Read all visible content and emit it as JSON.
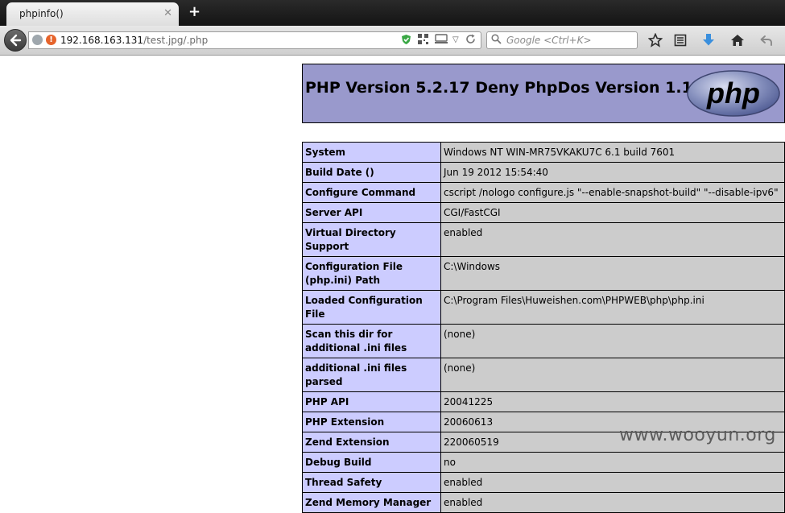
{
  "browser": {
    "tab_title": "phpinfo()",
    "tab_close_glyph": "✕",
    "new_tab_glyph": "+",
    "url_host": "192.168.163.131",
    "url_path": "/test.jpg/.php",
    "search_placeholder": "Google <Ctrl+K>",
    "icons": [
      "back-arrow-icon",
      "globe-icon",
      "warning-icon",
      "shield-icon",
      "qr-code-icon",
      "compatibility-icon",
      "dropdown-icon",
      "reload-icon",
      "search-icon",
      "bookmark-star-icon",
      "bookmarks-list-icon",
      "downloads-icon",
      "home-icon",
      "undo-icon"
    ]
  },
  "phpinfo": {
    "header_title": "PHP Version 5.2.17 Deny PhpDos Version 1.1",
    "logo_text": "php",
    "header_bg": "#9999cc",
    "key_bg": "#ccccff",
    "value_bg": "#cccccc",
    "rows": [
      {
        "key": "System",
        "value": "Windows NT WIN-MR75VKAKU7C 6.1 build 7601"
      },
      {
        "key": "Build Date ()",
        "value": "Jun 19 2012 15:54:40"
      },
      {
        "key": "Configure Command",
        "value": "cscript /nologo configure.js \"--enable-snapshot-build\" \"--disable-ipv6\""
      },
      {
        "key": "Server API",
        "value": "CGI/FastCGI"
      },
      {
        "key": "Virtual Directory Support",
        "value": "enabled"
      },
      {
        "key": "Configuration File (php.ini) Path",
        "value": "C:\\Windows"
      },
      {
        "key": "Loaded Configuration File",
        "value": "C:\\Program Files\\Huweishen.com\\PHPWEB\\php\\php.ini"
      },
      {
        "key": "Scan this dir for additional .ini files",
        "value": "(none)"
      },
      {
        "key": "additional .ini files parsed",
        "value": "(none)"
      },
      {
        "key": "PHP API",
        "value": "20041225"
      },
      {
        "key": "PHP Extension",
        "value": "20060613"
      },
      {
        "key": "Zend Extension",
        "value": "220060519"
      },
      {
        "key": "Debug Build",
        "value": "no"
      },
      {
        "key": "Thread Safety",
        "value": "enabled"
      },
      {
        "key": "Zend Memory Manager",
        "value": "enabled"
      }
    ]
  },
  "watermark": "www.wooyun.org"
}
